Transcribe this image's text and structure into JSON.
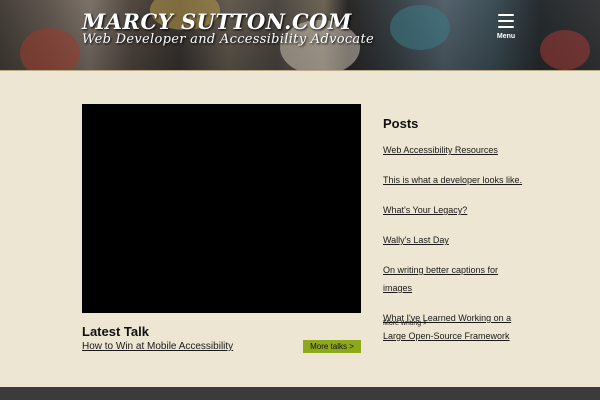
{
  "header": {
    "site_title": "MARCY SUTTON.COM",
    "tagline": "Web Developer and Accessibility Advocate",
    "menu_label": "Menu"
  },
  "latest_talk": {
    "heading": "Latest Talk",
    "title": "How to Win at Mobile Accessibility",
    "more_label": "More talks >"
  },
  "posts": {
    "heading": "Posts",
    "items": [
      "Web Accessibility Resources",
      "This is what a developer looks like.",
      "What's Your Legacy?",
      "Wally's Last Day",
      "On writing better captions for images",
      "What I've Learned Working on a Large Open-Source Framework"
    ],
    "more_label": "More writing >"
  },
  "colors": {
    "page_bg": "#ece6d2",
    "accent_button": "#8ea81c",
    "footer": "#3b3b3b"
  }
}
